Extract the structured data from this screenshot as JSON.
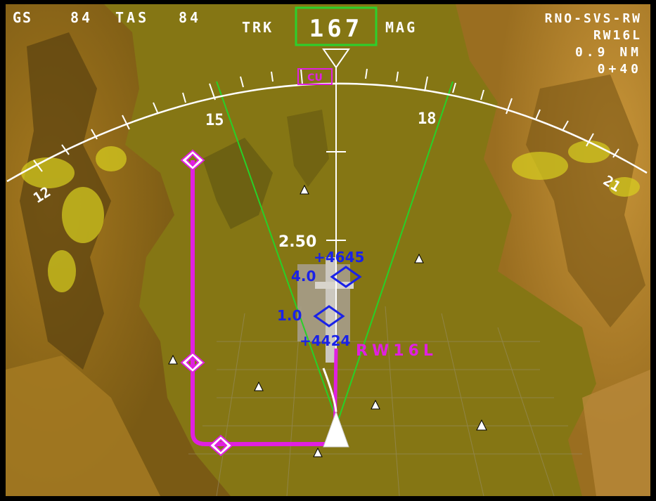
{
  "header": {
    "gs_label": "GS",
    "gs_value": "84",
    "tas_label": "TAS",
    "tas_value": "84",
    "trk_label": "TRK",
    "heading_value": "167",
    "mag_label": "MAG"
  },
  "nav_info": {
    "destination": "RNO-SVS-RW",
    "runway": "RW16L",
    "distance": "0.9 NM",
    "eta": "0+40"
  },
  "compass": {
    "label_15": "15",
    "label_18": "18",
    "label_12": "12",
    "label_21": "21",
    "target_box_label": "CU"
  },
  "overlay": {
    "scale_value": "2.50",
    "alt_top": "+4645",
    "range_4": "4.0",
    "range_1": "1.0",
    "alt_bottom": "+4424",
    "runway_label": "RW16L"
  },
  "colors": {
    "terrain": "#8a7a1c",
    "route": "#e020e0",
    "heading_box": "#2cd02c",
    "range_marker": "#1a22e8",
    "hud": "#ffffff"
  }
}
